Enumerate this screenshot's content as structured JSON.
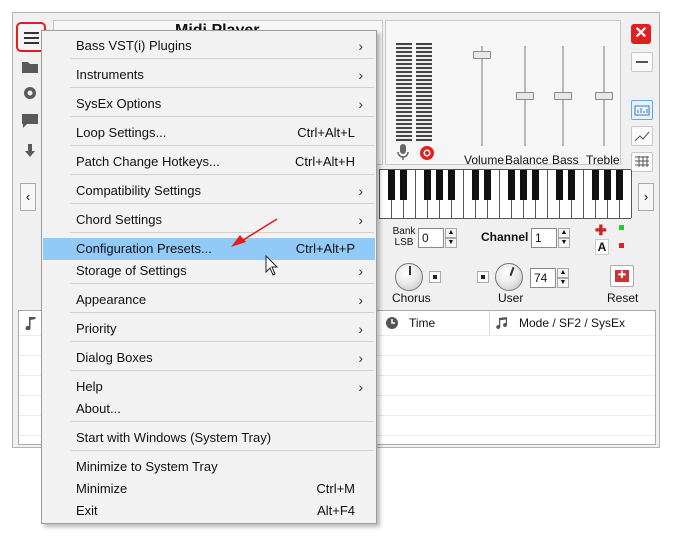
{
  "window": {
    "title": "Midi Player"
  },
  "colors": {
    "accent_red": "#e02020",
    "menu_highlight": "#91c9f7",
    "menu_background": "#f2f2f2",
    "window_background": "#f0f0f0"
  },
  "left_toolbar": {
    "icons": [
      "menu-icon",
      "folder-icon",
      "gear-icon",
      "chat-icon",
      "download-icon"
    ]
  },
  "sliders": {
    "labels": [
      "Volume",
      "Balance",
      "Bass",
      "Treble"
    ],
    "levels": [
      0.95,
      0.5,
      0.5,
      0.5
    ]
  },
  "controls": {
    "bank_lsb_label": "Bank\nLSB",
    "bank_lsb_value": "0",
    "channel_label": "Channel",
    "channel_value": "1",
    "user_value": "74",
    "chorus_label": "Chorus",
    "user_label": "User",
    "reset_label": "Reset",
    "a_label": "A"
  },
  "list": {
    "columns": [
      "Time",
      "Mode / SF2 / SysEx"
    ]
  },
  "menu": {
    "items": [
      {
        "label": "Bass VST(i) Plugins",
        "shortcut": "",
        "submenu": true
      },
      {
        "label": "Instruments",
        "shortcut": "",
        "submenu": true
      },
      {
        "label": "SysEx Options",
        "shortcut": "",
        "submenu": true
      },
      {
        "label": "Loop Settings...",
        "shortcut": "Ctrl+Alt+L",
        "submenu": false
      },
      {
        "label": "Patch Change Hotkeys...",
        "shortcut": "Ctrl+Alt+H",
        "submenu": false
      },
      {
        "label": "Compatibility Settings",
        "shortcut": "",
        "submenu": true
      },
      {
        "label": "Chord Settings",
        "shortcut": "",
        "submenu": true
      },
      {
        "label": "Configuration Presets...",
        "shortcut": "Ctrl+Alt+P",
        "submenu": false,
        "highlighted": true
      },
      {
        "label": "Storage of Settings",
        "shortcut": "",
        "submenu": true
      },
      {
        "label": "Appearance",
        "shortcut": "",
        "submenu": true
      },
      {
        "label": "Priority",
        "shortcut": "",
        "submenu": true
      },
      {
        "label": "Dialog Boxes",
        "shortcut": "",
        "submenu": true
      },
      {
        "label": "Help",
        "shortcut": "",
        "submenu": true
      },
      {
        "label": "About...",
        "shortcut": "",
        "submenu": false
      },
      {
        "label": "Start with Windows (System Tray)",
        "shortcut": "",
        "submenu": false
      },
      {
        "label": "Minimize to System Tray",
        "shortcut": "",
        "submenu": false
      },
      {
        "label": "Minimize",
        "shortcut": "Ctrl+M",
        "submenu": false
      },
      {
        "label": "Exit",
        "shortcut": "Alt+F4",
        "submenu": false
      }
    ],
    "submenu_arrow": "›"
  }
}
